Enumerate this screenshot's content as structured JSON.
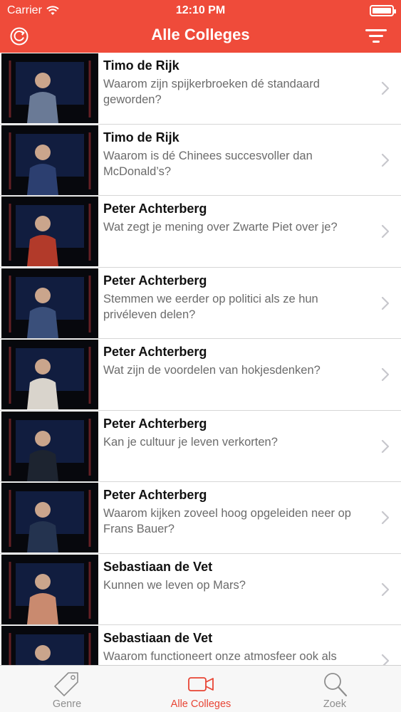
{
  "status_bar": {
    "carrier": "Carrier",
    "time": "12:10 PM"
  },
  "nav": {
    "title": "Alle Colleges",
    "left_icon": "refresh-icon",
    "right_icon": "filter-icon"
  },
  "colors": {
    "accent": "#ef4b3a",
    "tab_active": "#e84535"
  },
  "lectures": [
    {
      "speaker": "Timo de Rijk",
      "question": "Waarom zijn spijkerbroeken dé standaard geworden?"
    },
    {
      "speaker": "Timo de Rijk",
      "question": "Waarom is dé Chinees succesvoller dan McDonald’s?"
    },
    {
      "speaker": "Peter Achterberg",
      "question": "Wat zegt je mening over Zwarte Piet over je?"
    },
    {
      "speaker": "Peter Achterberg",
      "question": "Stemmen we eerder op politici als ze hun privéleven delen?"
    },
    {
      "speaker": "Peter Achterberg",
      "question": "Wat zijn de voordelen van hokjesdenken?"
    },
    {
      "speaker": "Peter Achterberg",
      "question": "Kan je cultuur je leven verkorten?"
    },
    {
      "speaker": "Peter Achterberg",
      "question": "Waarom kijken zoveel hoog opgeleiden neer op Frans Bauer?"
    },
    {
      "speaker": "Sebastiaan de Vet",
      "question": "Kunnen we leven op Mars?"
    },
    {
      "speaker": "Sebastiaan de Vet",
      "question": "Waarom functioneert onze atmosfeer ook als"
    }
  ],
  "tabs": [
    {
      "label": "Genre",
      "icon": "tag-icon",
      "active": false
    },
    {
      "label": "Alle Colleges",
      "icon": "video-camera-icon",
      "active": true
    },
    {
      "label": "Zoek",
      "icon": "search-icon",
      "active": false
    }
  ]
}
